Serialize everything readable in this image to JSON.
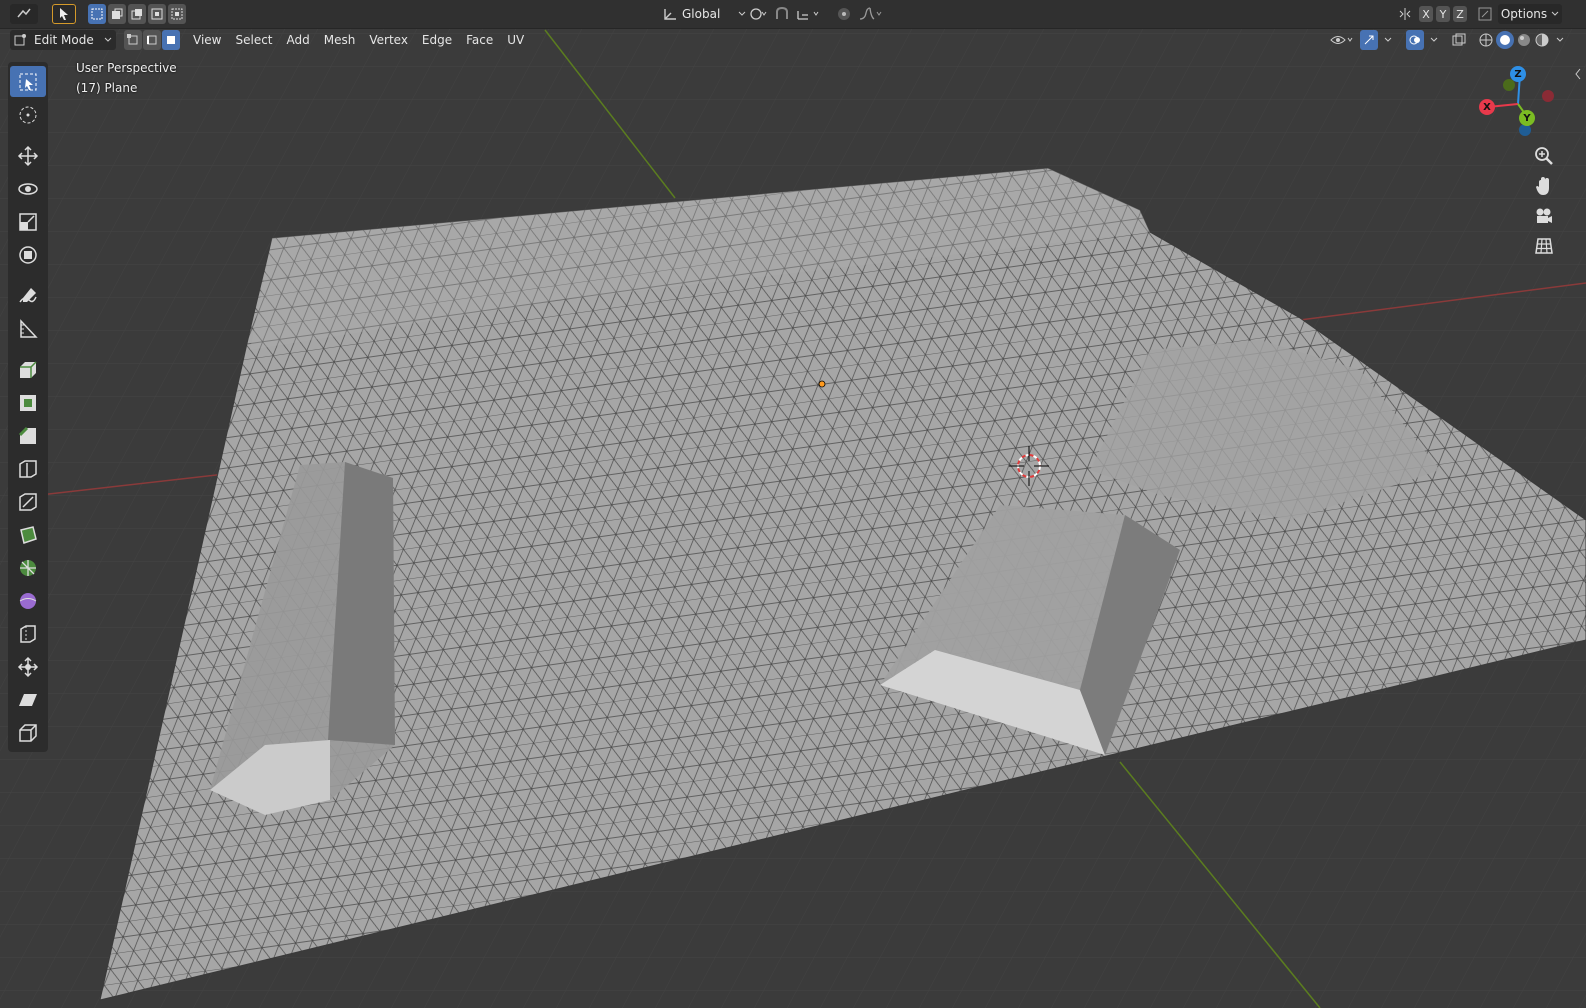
{
  "header": {
    "mode_label": "Edit Mode",
    "orientation_label": "Global",
    "menus": [
      "View",
      "Select",
      "Add",
      "Mesh",
      "Vertex",
      "Edge",
      "Face",
      "UV"
    ],
    "axis_labels": [
      "X",
      "Y",
      "Z"
    ],
    "options_label": "Options"
  },
  "viewport": {
    "perspective_label": "User Perspective",
    "object_label": "(17) Plane"
  },
  "gizmo": {
    "x_label": "X",
    "y_label": "Y",
    "z_label": "Z"
  },
  "tools": [
    "select-box-icon",
    "cursor-icon",
    "move-icon",
    "rotate-icon",
    "scale-icon",
    "transform-icon",
    "annotate-icon",
    "measure-icon",
    "extrude-icon",
    "inset-icon",
    "bevel-icon",
    "loop-cut-icon",
    "knife-icon",
    "poly-build-icon",
    "spin-icon",
    "smooth-icon",
    "edge-slide-icon",
    "shrink-fatten-icon",
    "shear-icon",
    "rip-icon"
  ],
  "colors": {
    "background": "#3a3a3a",
    "accent": "#4772b3",
    "axis_x": "#e8394b",
    "axis_y": "#7bbc23",
    "axis_z": "#2e8fe6",
    "mesh_face": "#a7a7a7"
  }
}
